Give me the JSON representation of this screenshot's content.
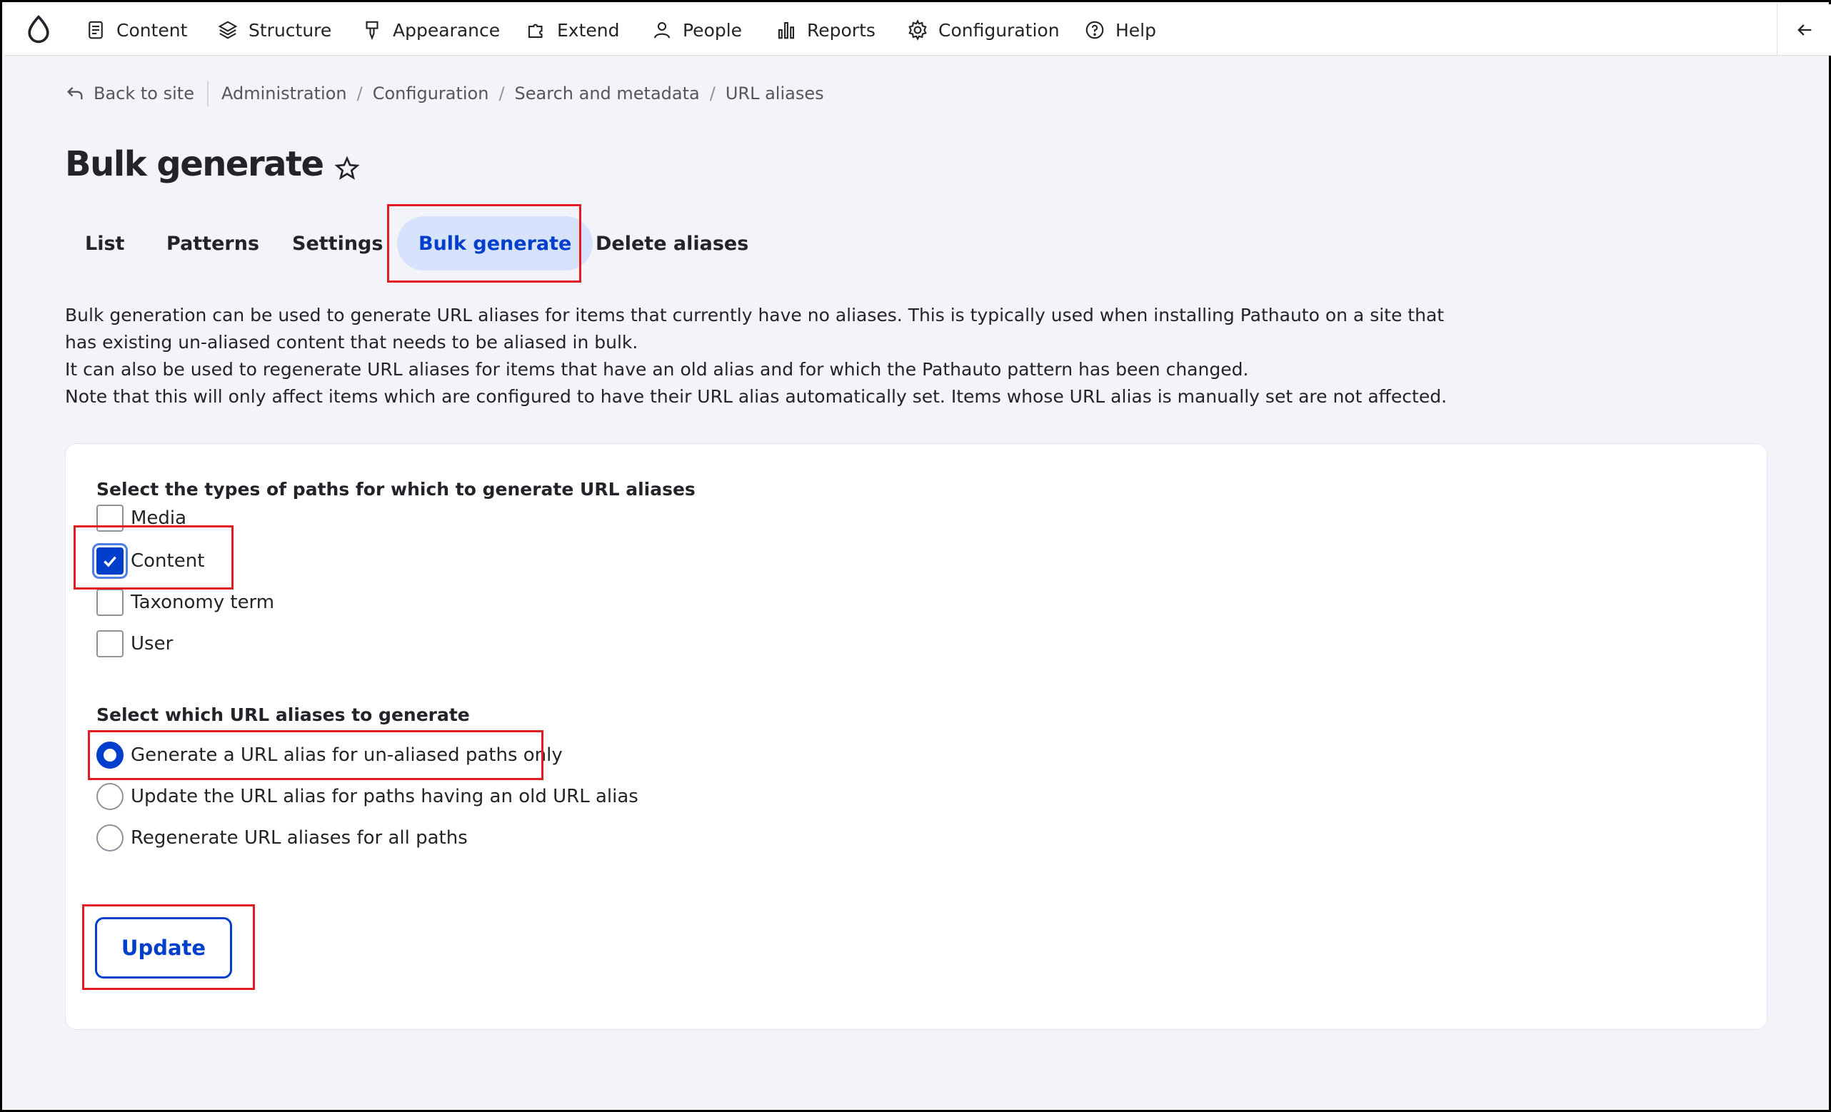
{
  "toolbar": {
    "items": [
      {
        "label": "Content",
        "icon": "document-icon"
      },
      {
        "label": "Structure",
        "icon": "layers-icon"
      },
      {
        "label": "Appearance",
        "icon": "paintbrush-icon"
      },
      {
        "label": "Extend",
        "icon": "puzzle-icon"
      },
      {
        "label": "People",
        "icon": "person-icon"
      },
      {
        "label": "Reports",
        "icon": "bar-chart-icon"
      },
      {
        "label": "Configuration",
        "icon": "gear-icon"
      },
      {
        "label": "Help",
        "icon": "help-icon"
      }
    ]
  },
  "breadcrumb": {
    "back": "Back to site",
    "items": [
      "Administration",
      "Configuration",
      "Search and metadata",
      "URL aliases"
    ]
  },
  "page": {
    "title": "Bulk generate"
  },
  "tabs": {
    "items": [
      "List",
      "Patterns",
      "Settings",
      "Bulk generate",
      "Delete aliases"
    ],
    "active": "Bulk generate"
  },
  "description": {
    "line1": "Bulk generation can be used to generate URL aliases for items that currently have no aliases. This is typically used when installing Pathauto on a site that",
    "line2": "has existing un-aliased content that needs to be aliased in bulk.",
    "line3": "It can also be used to regenerate URL aliases for items that have an old alias and for which the Pathauto pattern has been changed.",
    "line4": "Note that this will only affect items which are configured to have their URL alias automatically set. Items whose URL alias is manually set are not affected."
  },
  "form": {
    "types_legend": "Select the types of paths for which to generate URL aliases",
    "types": [
      {
        "label": "Media",
        "checked": false
      },
      {
        "label": "Content",
        "checked": true
      },
      {
        "label": "Taxonomy term",
        "checked": false
      },
      {
        "label": "User",
        "checked": false
      }
    ],
    "action_legend": "Select which URL aliases to generate",
    "actions": [
      {
        "label": "Generate a URL alias for un-aliased paths only",
        "selected": true
      },
      {
        "label": "Update the URL alias for paths having an old URL alias",
        "selected": false
      },
      {
        "label": "Regenerate URL aliases for all paths",
        "selected": false
      }
    ],
    "submit_label": "Update"
  },
  "colors": {
    "accent": "#003ecc",
    "active_tab_bg": "#d7e2fc",
    "highlight": "#e31b23"
  }
}
